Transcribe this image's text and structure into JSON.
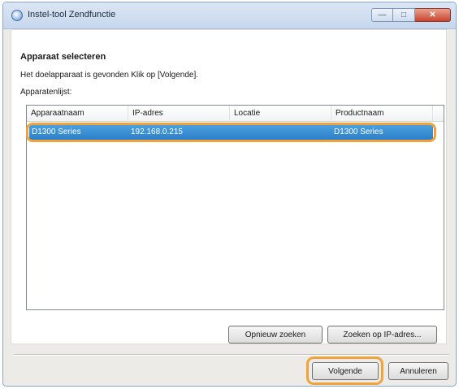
{
  "window": {
    "title": "Instel-tool Zendfunctie",
    "minimize_glyph": "—",
    "maximize_glyph": "□",
    "close_glyph": "✕"
  },
  "page": {
    "heading": "Apparaat selecteren",
    "instruction": "Het doelapparaat is gevonden Klik op [Volgende].",
    "list_label": "Apparatenlijst:"
  },
  "device_list": {
    "columns": [
      "Apparaatnaam",
      "IP-adres",
      "Locatie",
      "Productnaam"
    ],
    "rows": [
      {
        "name": "D1300 Series",
        "ip": "192.168.0.215",
        "location": "",
        "product": "D1300 Series",
        "selected": true
      }
    ]
  },
  "buttons": {
    "search_again": "Opnieuw zoeken",
    "search_by_ip": "Zoeken op IP-adres...",
    "next": "Volgende",
    "cancel": "Annuleren"
  },
  "colors": {
    "selection": "#3a8fd6",
    "highlight_outline": "#f1a33a",
    "window_border": "#8aa6c6"
  },
  "icons": {
    "title": "app-globe-icon"
  }
}
